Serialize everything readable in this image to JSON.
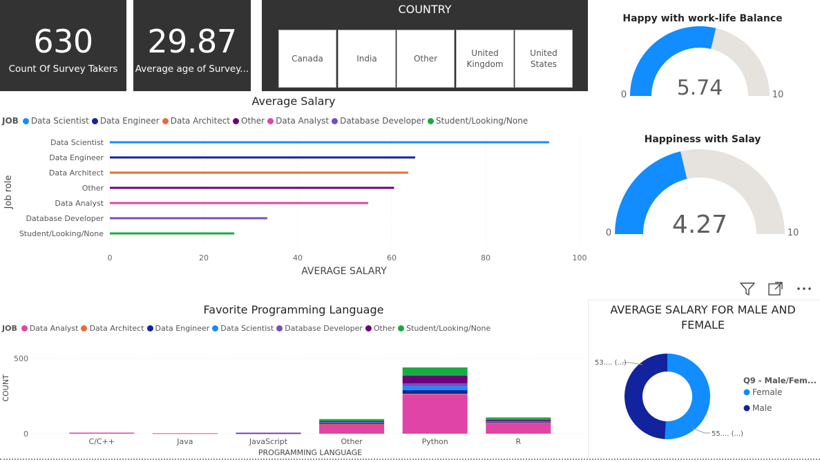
{
  "cards": [
    {
      "value": "630",
      "label": "Count Of Survey Takers"
    },
    {
      "value": "29.87",
      "label": "Average age of Survey..."
    }
  ],
  "country_slicer": {
    "title": "COUNTRY",
    "options": [
      "Canada",
      "India",
      "Other",
      "United Kingdom",
      "United States"
    ]
  },
  "avg_salary": {
    "title": "Average Salary",
    "legend_title": "JOB",
    "xlabel": "AVERAGE SALARY",
    "ylabel": "Job role"
  },
  "fav_lang": {
    "title": "Favorite Programming Language",
    "legend_title": "JOB",
    "xlabel": "PROGRAMMING LANGUAGE",
    "ylabel": "COUNT"
  },
  "gauges": [
    {
      "title": "Happy with work-life Balance",
      "value_label": "5.74",
      "min_label": "0",
      "max_label": "10"
    },
    {
      "title": "Happiness with Salay",
      "value_label": "4.27",
      "min_label": "0",
      "max_label": "10"
    }
  ],
  "donut": {
    "title": "AVERAGE SALARY FOR MALE AND FEMALE",
    "legend_title": "Q9 - Male/Fem...",
    "male_label": "53.... (...)",
    "female_label": "55.... (...)"
  },
  "colors": {
    "data_scientist": "#118DFF",
    "data_engineer": "#12239E",
    "data_architect": "#E66C37",
    "other": "#6B007B",
    "data_analyst": "#E044A7",
    "database_developer": "#744EC2",
    "student": "#1AAB40",
    "gauge_fill": "#118DFF",
    "gauge_track": "#E6E2DE",
    "card_bg": "#333333"
  },
  "chart_data": [
    {
      "type": "bar",
      "orientation": "horizontal",
      "title": "Average Salary",
      "legend_title": "JOB",
      "xlabel": "AVERAGE SALARY",
      "ylabel": "Job role",
      "categories": [
        "Data Scientist",
        "Data Engineer",
        "Data Architect",
        "Other",
        "Data Analyst",
        "Database Developer",
        "Student/Looking/None"
      ],
      "values": [
        93.5,
        65,
        63.5,
        60.5,
        55,
        33.5,
        26.5
      ],
      "xlim": [
        0,
        100
      ],
      "xticks": [
        0,
        20,
        40,
        60,
        80,
        100
      ],
      "grid": true,
      "legend": "top-left"
    },
    {
      "type": "bar",
      "stacked": true,
      "title": "Favorite Programming Language",
      "legend_title": "JOB",
      "xlabel": "PROGRAMMING LANGUAGE",
      "ylabel": "COUNT",
      "categories": [
        "C/C++",
        "Java",
        "JavaScript",
        "Other",
        "Python",
        "R"
      ],
      "series": [
        {
          "name": "Data Analyst",
          "values": [
            7,
            3,
            2,
            62,
            260,
            72
          ]
        },
        {
          "name": "Data Architect",
          "values": [
            0,
            0,
            1,
            2,
            5,
            2
          ]
        },
        {
          "name": "Data Engineer",
          "values": [
            0,
            0,
            1,
            5,
            25,
            5
          ]
        },
        {
          "name": "Data Scientist",
          "values": [
            0,
            0,
            2,
            4,
            25,
            3
          ]
        },
        {
          "name": "Database Developer",
          "values": [
            0,
            0,
            1,
            4,
            20,
            3
          ]
        },
        {
          "name": "Other",
          "values": [
            0,
            0,
            0,
            7,
            50,
            7
          ]
        },
        {
          "name": "Student/Looking/None",
          "values": [
            0,
            0,
            0,
            13,
            55,
            16
          ]
        }
      ],
      "yticks": [
        0,
        500
      ],
      "ylim": [
        0,
        500
      ],
      "grid": true,
      "legend": "top-left"
    },
    {
      "type": "pie",
      "donut": true,
      "title": "AVERAGE SALARY FOR MALE AND FEMALE",
      "legend_title": "Q9 - Male/Fem...",
      "categories": [
        "Female",
        "Male"
      ],
      "values": [
        55,
        53
      ],
      "legend": "right"
    },
    {
      "type": "gauge",
      "title": "Happy with work-life Balance",
      "value": 5.74,
      "min": 0,
      "max": 10
    },
    {
      "type": "gauge",
      "title": "Happiness with Salay",
      "value": 4.27,
      "min": 0,
      "max": 10
    }
  ]
}
